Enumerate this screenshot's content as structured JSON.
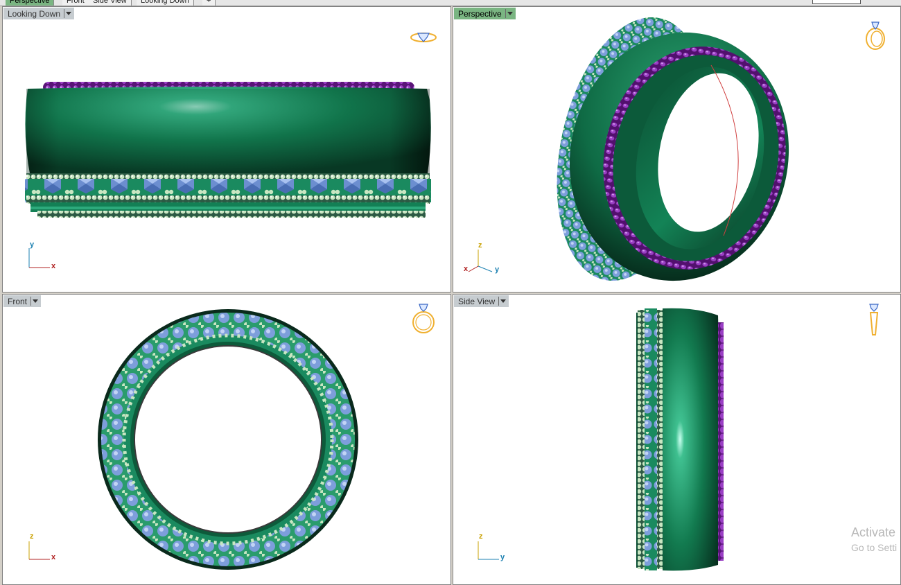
{
  "tabs": [
    {
      "label": "Perspective",
      "active": true
    },
    {
      "label": "Front",
      "active": false
    },
    {
      "label": "Side View",
      "active": false
    },
    {
      "label": "Looking Down",
      "active": false
    },
    {
      "label": "+",
      "active": false
    }
  ],
  "viewports": {
    "top_left": {
      "label": "Looking Down",
      "active": false,
      "axis1": "y",
      "axis2": "x",
      "icon": "ring-top-view-icon"
    },
    "top_right": {
      "label": "Perspective",
      "active": true,
      "axis1": "z",
      "axis2": "y",
      "axis3": "x",
      "icon": "ring-perspective-icon"
    },
    "bottom_left": {
      "label": "Front",
      "active": false,
      "axis1": "z",
      "axis2": "x",
      "icon": "ring-front-icon"
    },
    "bottom_right": {
      "label": "Side View",
      "active": false,
      "axis1": "z",
      "axis2": "y",
      "icon": "ring-side-icon"
    }
  },
  "watermark": {
    "line1": "Activate",
    "line2": "Go to Setti"
  },
  "colors": {
    "band": "#0e6b44",
    "band_light": "#7fe6c8",
    "twist": "#7a1e9a",
    "stone": "#7f9fd8",
    "bead": "#c7e5c1",
    "axis_y": "#1a7fb0",
    "axis_x": "#b02020",
    "axis_z": "#c8a000",
    "active_label": "#7ab582"
  }
}
